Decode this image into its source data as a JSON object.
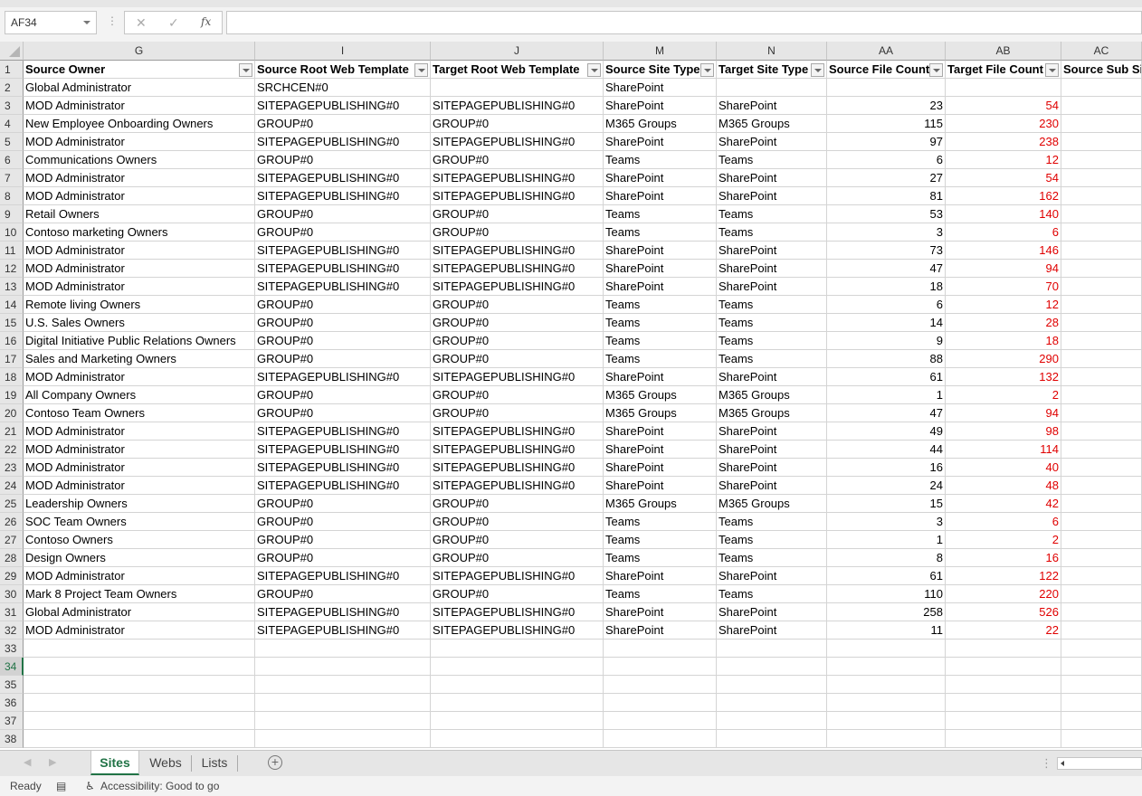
{
  "formula_bar": {
    "name_box": "AF34",
    "cancel_icon": "✕",
    "enter_icon": "✓",
    "fx_label": "fx",
    "formula": ""
  },
  "columns": [
    {
      "letter": "G",
      "header": "Source Owner"
    },
    {
      "letter": "I",
      "header": "Source Root Web Template"
    },
    {
      "letter": "J",
      "header": "Target Root Web Template"
    },
    {
      "letter": "M",
      "header": "Source Site Type"
    },
    {
      "letter": "N",
      "header": "Target Site Type"
    },
    {
      "letter": "AA",
      "header": "Source File Count"
    },
    {
      "letter": "AB",
      "header": "Target File Count"
    },
    {
      "letter": "AC",
      "header": "Source Sub Sit"
    }
  ],
  "rows": [
    [
      "Global Administrator",
      "SRCHCEN#0",
      "",
      "SharePoint",
      "",
      "",
      ""
    ],
    [
      "MOD Administrator",
      "SITEPAGEPUBLISHING#0",
      "SITEPAGEPUBLISHING#0",
      "SharePoint",
      "SharePoint",
      "23",
      "54"
    ],
    [
      "New Employee Onboarding Owners",
      "GROUP#0",
      "GROUP#0",
      "M365 Groups",
      "M365 Groups",
      "115",
      "230"
    ],
    [
      "MOD Administrator",
      "SITEPAGEPUBLISHING#0",
      "SITEPAGEPUBLISHING#0",
      "SharePoint",
      "SharePoint",
      "97",
      "238"
    ],
    [
      "Communications Owners",
      "GROUP#0",
      "GROUP#0",
      "Teams",
      "Teams",
      "6",
      "12"
    ],
    [
      "MOD Administrator",
      "SITEPAGEPUBLISHING#0",
      "SITEPAGEPUBLISHING#0",
      "SharePoint",
      "SharePoint",
      "27",
      "54"
    ],
    [
      "MOD Administrator",
      "SITEPAGEPUBLISHING#0",
      "SITEPAGEPUBLISHING#0",
      "SharePoint",
      "SharePoint",
      "81",
      "162"
    ],
    [
      "Retail Owners",
      "GROUP#0",
      "GROUP#0",
      "Teams",
      "Teams",
      "53",
      "140"
    ],
    [
      "Contoso marketing Owners",
      "GROUP#0",
      "GROUP#0",
      "Teams",
      "Teams",
      "3",
      "6"
    ],
    [
      "MOD Administrator",
      "SITEPAGEPUBLISHING#0",
      "SITEPAGEPUBLISHING#0",
      "SharePoint",
      "SharePoint",
      "73",
      "146"
    ],
    [
      "MOD Administrator",
      "SITEPAGEPUBLISHING#0",
      "SITEPAGEPUBLISHING#0",
      "SharePoint",
      "SharePoint",
      "47",
      "94"
    ],
    [
      "MOD Administrator",
      "SITEPAGEPUBLISHING#0",
      "SITEPAGEPUBLISHING#0",
      "SharePoint",
      "SharePoint",
      "18",
      "70"
    ],
    [
      "Remote living Owners",
      "GROUP#0",
      "GROUP#0",
      "Teams",
      "Teams",
      "6",
      "12"
    ],
    [
      "U.S. Sales Owners",
      "GROUP#0",
      "GROUP#0",
      "Teams",
      "Teams",
      "14",
      "28"
    ],
    [
      "Digital Initiative Public Relations Owners",
      "GROUP#0",
      "GROUP#0",
      "Teams",
      "Teams",
      "9",
      "18"
    ],
    [
      "Sales and Marketing Owners",
      "GROUP#0",
      "GROUP#0",
      "Teams",
      "Teams",
      "88",
      "290"
    ],
    [
      "MOD Administrator",
      "SITEPAGEPUBLISHING#0",
      "SITEPAGEPUBLISHING#0",
      "SharePoint",
      "SharePoint",
      "61",
      "132"
    ],
    [
      "All Company Owners",
      "GROUP#0",
      "GROUP#0",
      "M365 Groups",
      "M365 Groups",
      "1",
      "2"
    ],
    [
      "Contoso Team Owners",
      "GROUP#0",
      "GROUP#0",
      "M365 Groups",
      "M365 Groups",
      "47",
      "94"
    ],
    [
      "MOD Administrator",
      "SITEPAGEPUBLISHING#0",
      "SITEPAGEPUBLISHING#0",
      "SharePoint",
      "SharePoint",
      "49",
      "98"
    ],
    [
      "MOD Administrator",
      "SITEPAGEPUBLISHING#0",
      "SITEPAGEPUBLISHING#0",
      "SharePoint",
      "SharePoint",
      "44",
      "114"
    ],
    [
      "MOD Administrator",
      "SITEPAGEPUBLISHING#0",
      "SITEPAGEPUBLISHING#0",
      "SharePoint",
      "SharePoint",
      "16",
      "40"
    ],
    [
      "MOD Administrator",
      "SITEPAGEPUBLISHING#0",
      "SITEPAGEPUBLISHING#0",
      "SharePoint",
      "SharePoint",
      "24",
      "48"
    ],
    [
      "Leadership Owners",
      "GROUP#0",
      "GROUP#0",
      "M365 Groups",
      "M365 Groups",
      "15",
      "42"
    ],
    [
      "SOC Team Owners",
      "GROUP#0",
      "GROUP#0",
      "Teams",
      "Teams",
      "3",
      "6"
    ],
    [
      "Contoso Owners",
      "GROUP#0",
      "GROUP#0",
      "Teams",
      "Teams",
      "1",
      "2"
    ],
    [
      "Design Owners",
      "GROUP#0",
      "GROUP#0",
      "Teams",
      "Teams",
      "8",
      "16"
    ],
    [
      "MOD Administrator",
      "SITEPAGEPUBLISHING#0",
      "SITEPAGEPUBLISHING#0",
      "SharePoint",
      "SharePoint",
      "61",
      "122"
    ],
    [
      "Mark 8 Project Team Owners",
      "GROUP#0",
      "GROUP#0",
      "Teams",
      "Teams",
      "110",
      "220"
    ],
    [
      "Global Administrator",
      "SITEPAGEPUBLISHING#0",
      "SITEPAGEPUBLISHING#0",
      "SharePoint",
      "SharePoint",
      "258",
      "526"
    ],
    [
      "MOD Administrator",
      "SITEPAGEPUBLISHING#0",
      "SITEPAGEPUBLISHING#0",
      "SharePoint",
      "SharePoint",
      "11",
      "22"
    ]
  ],
  "row_numbers": [
    "1",
    "2",
    "3",
    "4",
    "5",
    "6",
    "7",
    "8",
    "9",
    "10",
    "11",
    "12",
    "13",
    "14",
    "15",
    "16",
    "17",
    "18",
    "19",
    "20",
    "21",
    "22",
    "23",
    "24",
    "25",
    "26",
    "27",
    "28",
    "29",
    "30",
    "31",
    "32",
    "33",
    "34",
    "35",
    "36",
    "37",
    "38"
  ],
  "selected_row": "34",
  "sheet_tabs": [
    {
      "label": "Sites",
      "active": true
    },
    {
      "label": "Webs",
      "active": false
    },
    {
      "label": "Lists",
      "active": false
    }
  ],
  "add_sheet": "+",
  "status_bar": {
    "mode": "Ready",
    "accessibility": "Accessibility: Good to go"
  },
  "colors": {
    "accent": "#217346",
    "target_count": "#e00000"
  }
}
